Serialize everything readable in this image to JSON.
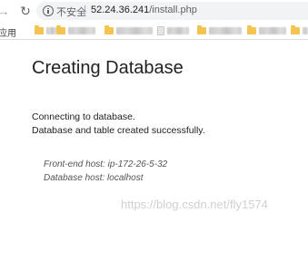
{
  "toolbar": {
    "back_icon": "arrow-left-icon",
    "reload_icon": "reload-icon",
    "security_icon": "info-circle-icon",
    "security_label": "不安全",
    "separator": "|",
    "url_host": "52.24.36.241",
    "url_path": "/install.php"
  },
  "bookmarks": {
    "apps_label": "应用"
  },
  "page": {
    "title": "Creating Database",
    "status": [
      "Connecting to database.",
      "Database and table created successfully."
    ],
    "hosts": [
      "Front-end host: ip-172-26-5-32",
      "Database host: localhost"
    ]
  },
  "watermark": "https://blog.csdn.net/fly1574",
  "colors": {
    "omnibox_bg": "#f1f3f4",
    "folder": "#f5c34f",
    "text": "#222222",
    "muted": "#555555"
  }
}
